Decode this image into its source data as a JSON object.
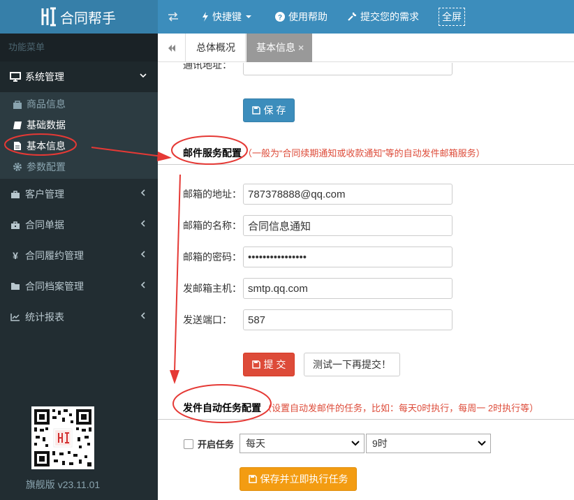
{
  "app": {
    "title": "合同帮手"
  },
  "topnav": {
    "toggle_icon": "exchange-icon",
    "shortcuts": "快捷键",
    "help": "使用帮助",
    "request": "提交您的需求",
    "fullscreen": "全屏"
  },
  "sidebar": {
    "header": "功能菜单",
    "system": "系统管理",
    "sub_items": [
      {
        "label": "商品信息",
        "icon": "shopping-bag-icon"
      },
      {
        "label": "基础数据",
        "icon": "book-icon"
      },
      {
        "label": "基本信息",
        "icon": "file-icon"
      },
      {
        "label": "参数配置",
        "icon": "gear-icon"
      }
    ],
    "items": [
      {
        "label": "客户管理",
        "icon": "briefcase-icon"
      },
      {
        "label": "合同单据",
        "icon": "suitcase-icon"
      },
      {
        "label": "合同履约管理",
        "icon": "yen-icon"
      },
      {
        "label": "合同档案管理",
        "icon": "folder-icon"
      },
      {
        "label": "统计报表",
        "icon": "line-chart-icon"
      }
    ],
    "version": "旗舰版 v23.11.01"
  },
  "tabs": {
    "overview": "总体概况",
    "active": "基本信息",
    "close": "×"
  },
  "content": {
    "address_label": "通讯地址：",
    "save_button": "保 存",
    "mail_section": {
      "title": "邮件服务配置",
      "note": "（一般为“合同续期通知或收款通知”等的自动发件邮箱服务）",
      "fields": [
        {
          "label": "邮箱的地址：",
          "value": "787378888@qq.com"
        },
        {
          "label": "邮箱的名称：",
          "value": "合同信息通知"
        },
        {
          "label": "邮箱的密码：",
          "value": "••••••••••••••••"
        },
        {
          "label": "发邮箱主机：",
          "value": "smtp.qq.com"
        },
        {
          "label": "发送端口：",
          "value": "587"
        }
      ],
      "submit_button": "提 交",
      "test_button": "测试一下再提交！"
    },
    "task_section": {
      "title": "发件自动任务配置",
      "note": "（设置自动发邮件的任务，比如：每天0时执行，每周一 2时执行等）",
      "enable_label": "开启任务",
      "frequency": "每天",
      "hour": "9时",
      "run_button": "保存并立即执行任务"
    }
  },
  "colors": {
    "header": "#3c8dbc",
    "sidebar": "#222d32",
    "annotation": "#e53935"
  }
}
